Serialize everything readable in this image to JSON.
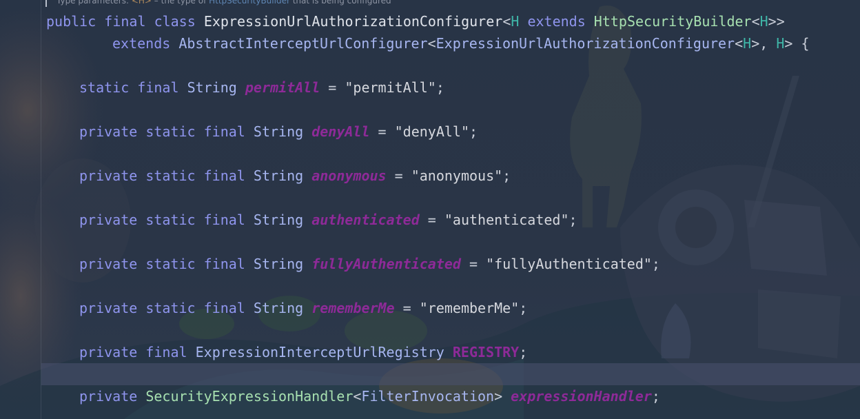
{
  "doc_hint": {
    "prefix": "Type parameters: ",
    "type_param": "<H>",
    "middle": " – the type of ",
    "link": "HttpSecurityBuilder",
    "suffix": " that is being configured"
  },
  "lines": {
    "l1": {
      "kw1": "public",
      "kw2": "final",
      "kw3": "class",
      "class_name": "ExpressionUrlAuthorizationConfigurer",
      "lt": "<",
      "tp": "H",
      "kw_ext": "extends",
      "iface": "HttpSecurityBuilder",
      "lt2": "<",
      "tp2": "H",
      "gt2": ">>"
    },
    "l2": {
      "kw": "extends",
      "super": "AbstractInterceptUrlConfigurer",
      "lt": "<",
      "inner": "ExpressionUrlAuthorizationConfigurer",
      "lt2": "<",
      "tp": "H",
      "gt_comma": ">, ",
      "tp2": "H",
      "tail": "> {"
    },
    "l3": {
      "kw1": "static",
      "kw2": "final",
      "type": "String",
      "field": "permitAll",
      "eq": " = ",
      "value": "\"permitAll\"",
      "semi": ";"
    },
    "l4": {
      "kw1": "private",
      "kw2": "static",
      "kw3": "final",
      "type": "String",
      "field": "denyAll",
      "eq": " = ",
      "value": "\"denyAll\"",
      "semi": ";"
    },
    "l5": {
      "kw1": "private",
      "kw2": "static",
      "kw3": "final",
      "type": "String",
      "field": "anonymous",
      "eq": " = ",
      "value": "\"anonymous\"",
      "semi": ";"
    },
    "l6": {
      "kw1": "private",
      "kw2": "static",
      "kw3": "final",
      "type": "String",
      "field": "authenticated",
      "eq": " = ",
      "value": "\"authenticated\"",
      "semi": ";"
    },
    "l7": {
      "kw1": "private",
      "kw2": "static",
      "kw3": "final",
      "type": "String",
      "field": "fullyAuthenticated",
      "eq": " = ",
      "value": "\"fullyAuthenticated\"",
      "semi": ";"
    },
    "l8": {
      "kw1": "private",
      "kw2": "static",
      "kw3": "final",
      "type": "String",
      "field": "rememberMe",
      "eq": " = ",
      "value": "\"rememberMe\"",
      "semi": ";"
    },
    "l9": {
      "kw1": "private",
      "kw2": "final",
      "type": "ExpressionInterceptUrlRegistry",
      "field": "REGISTRY",
      "semi": ";"
    },
    "l10": {
      "kw1": "private",
      "iface": "SecurityExpressionHandler",
      "lt": "<",
      "generic": "FilterInvocation",
      "gt": ">",
      "field": "expressionHandler",
      "semi": ";"
    }
  },
  "colors": {
    "background": "#27303f",
    "keyword": "#8f95ee",
    "field": "#8e2a98",
    "type_param": "#3fb6a8",
    "interface": "#a7e0b0",
    "current_line": "#3e4563"
  },
  "background_art": "anime-wallpaper-image"
}
